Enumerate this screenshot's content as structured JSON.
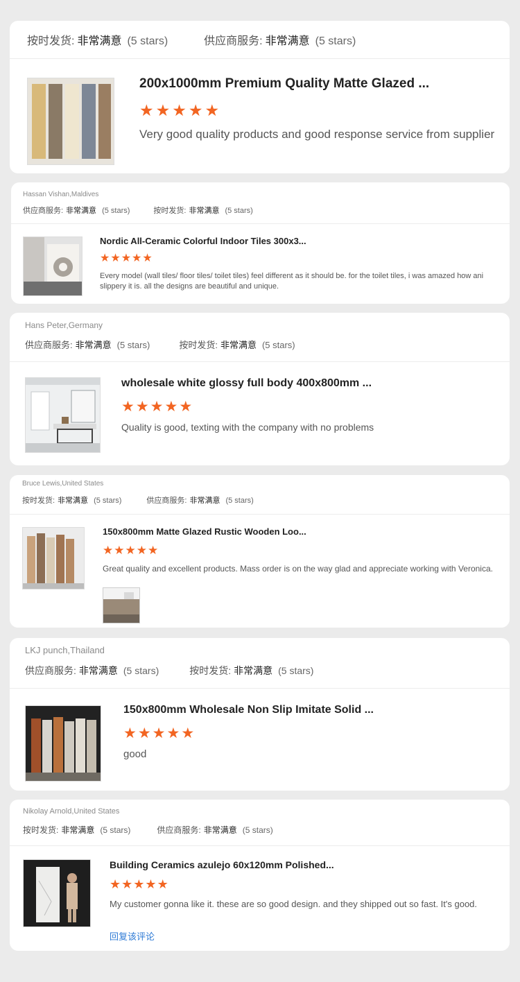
{
  "reviews": [
    {
      "reviewer": "",
      "ratings": [
        {
          "label": "按时发货:",
          "value": "非常满意",
          "stars": "(5 stars)"
        },
        {
          "label": "供应商服务:",
          "value": "非常满意",
          "stars": "(5 stars)"
        }
      ],
      "product_title": "200x1000mm Premium Quality Matte Glazed ...",
      "star_count": 5,
      "comment": "Very good quality products and good response service from supplier"
    },
    {
      "reviewer": "Hassan Vishan,Maldives",
      "ratings": [
        {
          "label": "供应商服务:",
          "value": "非常满意",
          "stars": "(5 stars)"
        },
        {
          "label": "按时发货:",
          "value": "非常满意",
          "stars": "(5 stars)"
        }
      ],
      "product_title": "Nordic All-Ceramic Colorful Indoor Tiles 300x3...",
      "star_count": 5,
      "comment": "Every model (wall tiles/ floor tiles/ toilet tiles) feel different as it should be. for the toilet tiles, i was amazed how ani slippery it is. all the designs are beautiful and unique."
    },
    {
      "reviewer": "Hans Peter,Germany",
      "ratings": [
        {
          "label": "供应商服务:",
          "value": "非常满意",
          "stars": "(5 stars)"
        },
        {
          "label": "按时发货:",
          "value": "非常满意",
          "stars": "(5 stars)"
        }
      ],
      "product_title": "wholesale white glossy full body 400x800mm ...",
      "star_count": 5,
      "comment": "Quality is good, texting with the company with no problems"
    },
    {
      "reviewer": "Bruce Lewis,United States",
      "ratings": [
        {
          "label": "按时发货:",
          "value": "非常满意",
          "stars": "(5 stars)"
        },
        {
          "label": "供应商服务:",
          "value": "非常满意",
          "stars": "(5 stars)"
        }
      ],
      "product_title": "150x800mm Matte Glazed Rustic Wooden Loo...",
      "star_count": 5,
      "comment": "Great quality and excellent products. Mass order is on the way glad and appreciate working with Veronica."
    },
    {
      "reviewer": "LKJ punch,Thailand",
      "ratings": [
        {
          "label": "供应商服务:",
          "value": "非常满意",
          "stars": "(5 stars)"
        },
        {
          "label": "按时发货:",
          "value": "非常满意",
          "stars": "(5 stars)"
        }
      ],
      "product_title": "150x800mm Wholesale Non Slip Imitate Solid ...",
      "star_count": 5,
      "comment": "good"
    },
    {
      "reviewer": "Nikolay Arnold,United States",
      "ratings": [
        {
          "label": "按时发货:",
          "value": "非常满意",
          "stars": "(5 stars)"
        },
        {
          "label": "供应商服务:",
          "value": "非常满意",
          "stars": "(5 stars)"
        }
      ],
      "product_title": "Building Ceramics azulejo 60x120mm Polished...",
      "star_count": 5,
      "comment": "My customer gonna like it. these are so good design. and they shipped out so fast. It's good.",
      "reply_label": "回复该评论"
    }
  ],
  "colors": {
    "star": "#f26522",
    "link": "#2f7bd6",
    "background": "#ebebeb"
  }
}
